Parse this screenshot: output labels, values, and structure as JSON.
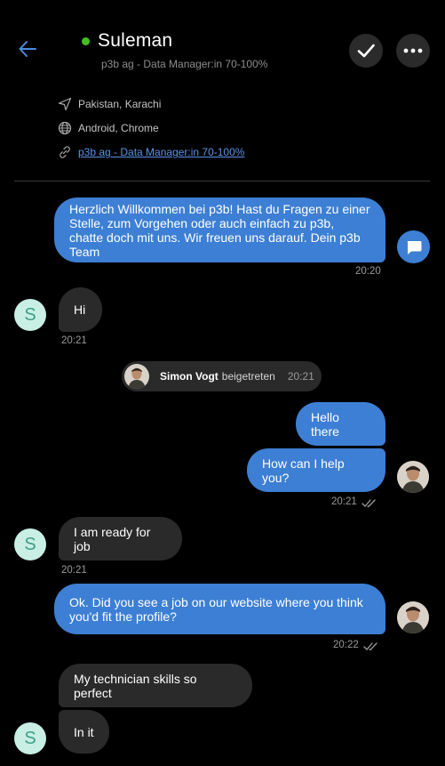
{
  "header": {
    "back_icon": "arrow-left-icon",
    "contact_name": "Suleman",
    "contact_subtitle": "p3b ag - Data Manager:in 70-100%",
    "online_color": "#3fc11f",
    "check_icon": "checkmark-icon",
    "more_icon": "more-dots-icon"
  },
  "visitor_info": {
    "location": "Pakistan, Karachi",
    "device": "Android, Chrome",
    "page_link": "p3b ag - Data Manager:in 70-100%"
  },
  "messages": {
    "welcome": {
      "text": "Herzlich Willkommen bei p3b! Hast du Fragen zu einer Stelle, zum Vorgehen oder auch einfach zu p3b, chatte doch mit uns. Wir freuen uns darauf. Dein p3b Team",
      "time": "20:20"
    },
    "hi": {
      "text": "Hi",
      "time": "20:21"
    },
    "join": {
      "name": "Simon Vogt",
      "action": "beigetreten",
      "time": "20:21"
    },
    "hello": {
      "text": "Hello there"
    },
    "help": {
      "text": "How can I help you?",
      "time": "20:21"
    },
    "ready": {
      "text": "I am ready for job",
      "time": "20:21"
    },
    "ok": {
      "text": "Ok. Did you see a job on our website where you think you'd fit  the profile?",
      "time": "20:22"
    },
    "skills": {
      "text": "My technician skills so perfect"
    },
    "init": {
      "text": "In it"
    }
  },
  "avatars": {
    "visitor_initial": "S"
  },
  "colors": {
    "accent": "#3d7fd4",
    "incoming_bubble": "#2a2a2a",
    "background": "#000000"
  }
}
